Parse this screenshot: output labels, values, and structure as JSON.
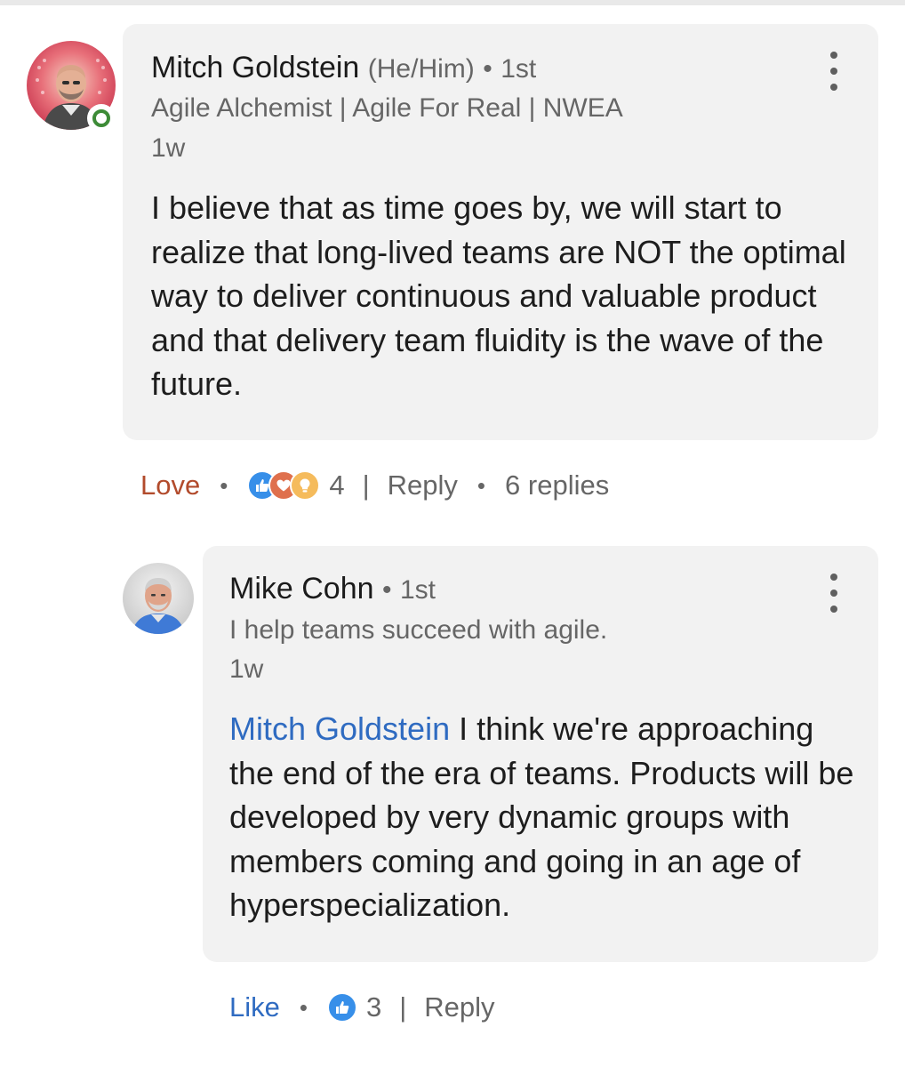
{
  "comment": {
    "author_name": "Mitch Goldstein",
    "pronouns": "(He/Him)",
    "connection_degree": "1st",
    "headline": "Agile Alchemist | Agile For Real | NWEA",
    "time_ago": "1w",
    "text": "I believe that as time goes by, we will start to realize that long-lived teams are NOT the optimal way to deliver continuous and valuable product and that delivery team fluidity is the wave of the future.",
    "online_status": "online",
    "actions": {
      "reaction_label": "Love",
      "reaction_icons": [
        "like-icon",
        "love-icon",
        "insightful-icon"
      ],
      "reaction_count": "4",
      "reply_label": "Reply",
      "replies_count": "6 replies"
    }
  },
  "reply": {
    "author_name": "Mike Cohn",
    "connection_degree": "1st",
    "headline": "I help teams succeed with agile.",
    "time_ago": "1w",
    "mention": "Mitch Goldstein",
    "text": "I think we're approaching the end of the era of teams. Products will be developed by very dynamic groups with members coming and going in an age of hyperspecialization.",
    "actions": {
      "reaction_label": "Like",
      "reaction_icons": [
        "like-icon"
      ],
      "reaction_count": "3",
      "reply_label": "Reply"
    }
  },
  "colors": {
    "bubble_background": "#f2f2f2",
    "love_reaction": "#b24b2c",
    "like_reaction": "#2f6bc1",
    "mention_link": "#2f6bc1",
    "online_indicator": "#3d8b37",
    "secondary_text": "#666666"
  }
}
